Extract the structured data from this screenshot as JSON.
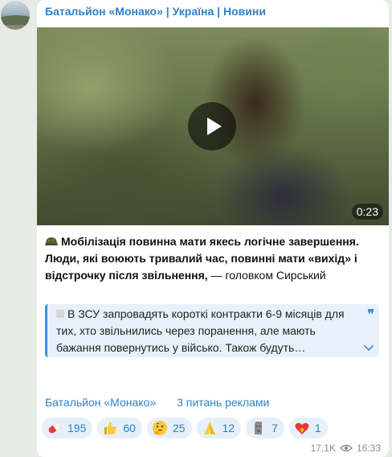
{
  "channel": {
    "name": "Батальйон «Монако» | Україна | Новини"
  },
  "video": {
    "duration": "0:23"
  },
  "post": {
    "bold_text": "Мобілізація повинна мати якесь логічне завершення. Люди, які воюють тривалий час, повинні мати «вихід» і відстрочку після звільнення,",
    "suffix": " — головком Сирський",
    "icon": "military-helmet-icon"
  },
  "quote": {
    "text": "В ЗСУ запровадять короткі контракти 6-9 місяців для тих, хто звільнились через поранення, але мають бажання повернутись у військо. Також будуть…"
  },
  "footer": {
    "link1": "Батальйон «Монако»",
    "link2": "3 питань реклами"
  },
  "reactions": [
    {
      "icon": "pill-icon",
      "count": "195"
    },
    {
      "icon": "thumbs-up-icon",
      "count": "60"
    },
    {
      "icon": "thinking-face-icon",
      "count": "25"
    },
    {
      "icon": "praying-hands-icon",
      "count": "12"
    },
    {
      "icon": "moai-icon",
      "count": "7"
    },
    {
      "icon": "heart-on-fire-icon",
      "count": "1"
    }
  ],
  "meta": {
    "views": "17.1K",
    "time": "16:33"
  },
  "colors": {
    "link": "#2e82c9",
    "reaction_bg": "#e6f0fa",
    "quote_bar": "#3f8fd8"
  }
}
